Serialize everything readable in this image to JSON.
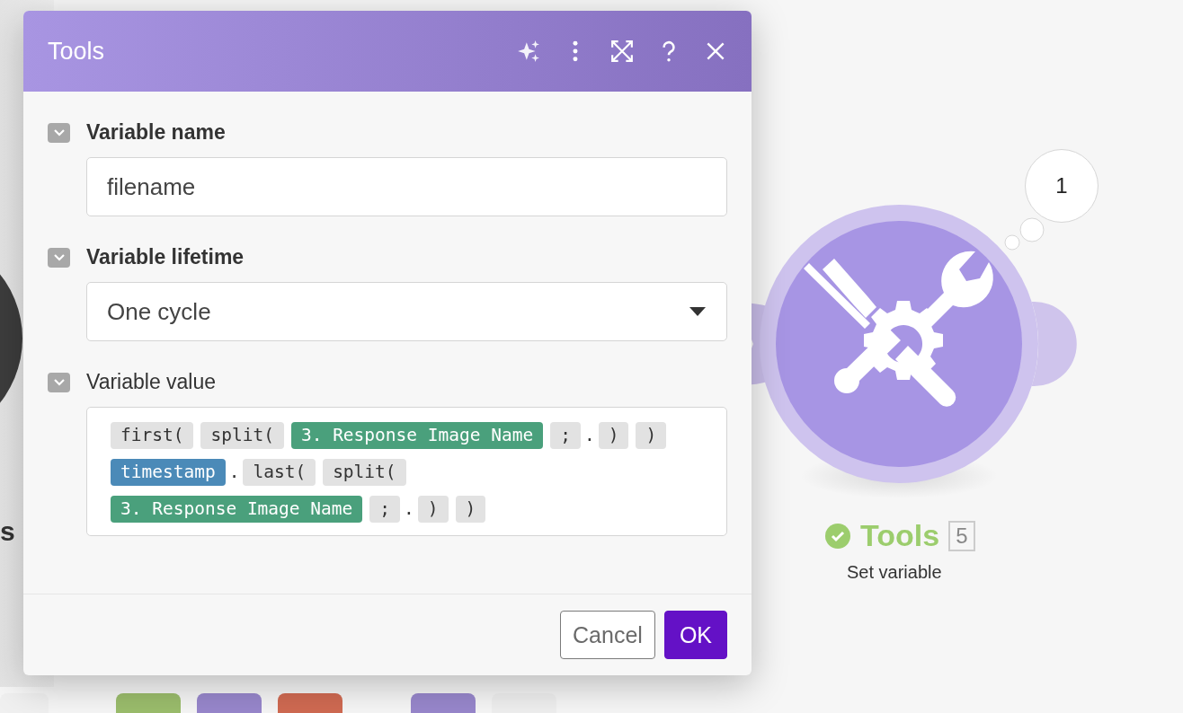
{
  "dialog": {
    "title": "Tools",
    "fields": [
      {
        "kind": "input",
        "label": "Variable name",
        "required": true,
        "value": "filename"
      },
      {
        "kind": "select",
        "label": "Variable lifetime",
        "required": true,
        "value": "One cycle"
      },
      {
        "kind": "tokens",
        "label": "Variable value",
        "required": false,
        "lines": [
          [
            {
              "kind": "fn",
              "text": "first("
            },
            {
              "kind": "fn",
              "text": "split("
            },
            {
              "kind": "item",
              "text": "3. Response Image Name"
            },
            {
              "kind": "fn",
              "text": ";"
            },
            {
              "kind": "plain",
              "text": "."
            },
            {
              "kind": "fn",
              "text": ")"
            },
            {
              "kind": "fn",
              "text": ")"
            }
          ],
          [
            {
              "kind": "builtin",
              "text": "timestamp"
            },
            {
              "kind": "plain",
              "text": "."
            },
            {
              "kind": "fn",
              "text": "last("
            },
            {
              "kind": "fn",
              "text": "split("
            }
          ],
          [
            {
              "kind": "item",
              "text": "3. Response Image Name"
            },
            {
              "kind": "fn",
              "text": ";"
            },
            {
              "kind": "plain",
              "text": "."
            },
            {
              "kind": "fn",
              "text": ")"
            },
            {
              "kind": "fn",
              "text": ")"
            }
          ]
        ]
      }
    ],
    "buttons": [
      {
        "kind": "secondary",
        "label": "Cancel"
      },
      {
        "kind": "primary",
        "label": "OK"
      }
    ]
  },
  "node": {
    "title": "Tools",
    "count": "5",
    "subtitle": "Set variable",
    "bubble": "1"
  },
  "left_node": {
    "label_fragment": "s"
  },
  "toolbar": [
    {
      "color": "#f0f0f0"
    },
    {
      "color": "#9bbd6c"
    },
    {
      "color": "#9887cc"
    },
    {
      "color": "#d06a52"
    },
    {
      "color": "#9887cc"
    },
    {
      "color": "#efefef"
    }
  ]
}
